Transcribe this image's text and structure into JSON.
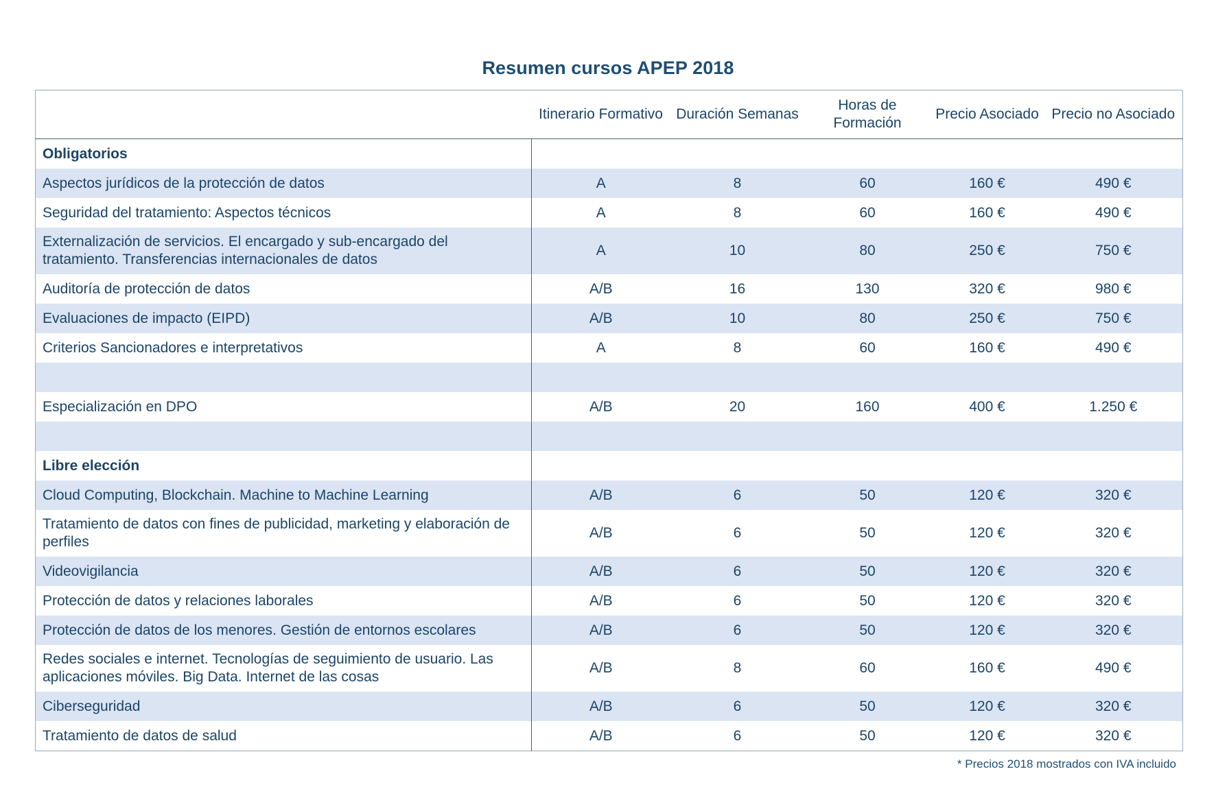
{
  "title": "Resumen cursos APEP 2018",
  "headers": {
    "course": "",
    "itinerario": "Itinerario Formativo",
    "duracion": "Duración Semanas",
    "horas": "Horas de Formación",
    "precio_asociado": "Precio Asociado",
    "precio_no_asociado": "Precio no Asociado"
  },
  "sections": {
    "obligatorios": "Obligatorios",
    "libre": "Libre elección"
  },
  "obligatorios": [
    {
      "name": "Aspectos jurídicos de la protección de datos",
      "itin": "A",
      "dur": "8",
      "hrs": "60",
      "pa": "160 €",
      "pna": "490 €"
    },
    {
      "name": "Seguridad del tratamiento: Aspectos técnicos",
      "itin": "A",
      "dur": "8",
      "hrs": "60",
      "pa": "160 €",
      "pna": "490 €"
    },
    {
      "name": "Externalización de servicios. El encargado y sub-encargado del tratamiento. Transferencias internacionales de datos",
      "itin": "A",
      "dur": "10",
      "hrs": "80",
      "pa": "250 €",
      "pna": "750 €"
    },
    {
      "name": "Auditoría de protección de datos",
      "itin": "A/B",
      "dur": "16",
      "hrs": "130",
      "pa": "320 €",
      "pna": "980 €"
    },
    {
      "name": "Evaluaciones de impacto (EIPD)",
      "itin": "A/B",
      "dur": "10",
      "hrs": "80",
      "pa": "250 €",
      "pna": "750 €"
    },
    {
      "name": "Criterios Sancionadores e interpretativos",
      "itin": "A",
      "dur": "8",
      "hrs": "60",
      "pa": "160 €",
      "pna": "490 €"
    }
  ],
  "especializacion": {
    "name": "Especialización en DPO",
    "itin": "A/B",
    "dur": "20",
    "hrs": "160",
    "pa": "400 €",
    "pna": "1.250 €"
  },
  "libre": [
    {
      "name": "Cloud Computing, Blockchain. Machine to Machine Learning",
      "itin": "A/B",
      "dur": "6",
      "hrs": "50",
      "pa": "120 €",
      "pna": "320 €"
    },
    {
      "name": "Tratamiento de datos con fines de publicidad, marketing y elaboración de perfiles",
      "itin": "A/B",
      "dur": "6",
      "hrs": "50",
      "pa": "120 €",
      "pna": "320 €"
    },
    {
      "name": "Videovigilancia",
      "itin": "A/B",
      "dur": "6",
      "hrs": "50",
      "pa": "120 €",
      "pna": "320 €"
    },
    {
      "name": "Protección de datos y relaciones laborales",
      "itin": "A/B",
      "dur": "6",
      "hrs": "50",
      "pa": "120 €",
      "pna": "320 €"
    },
    {
      "name": "Protección de datos de los menores. Gestión de entornos escolares",
      "itin": "A/B",
      "dur": "6",
      "hrs": "50",
      "pa": "120 €",
      "pna": "320 €"
    },
    {
      "name": "Redes sociales e internet. Tecnologías de seguimiento de usuario. Las aplicaciones móviles. Big Data. Internet de las cosas",
      "itin": "A/B",
      "dur": "8",
      "hrs": "60",
      "pa": "160 €",
      "pna": "490 €"
    },
    {
      "name": "Ciberseguridad",
      "itin": "A/B",
      "dur": "6",
      "hrs": "50",
      "pa": "120 €",
      "pna": "320 €"
    },
    {
      "name": "Tratamiento de datos de salud",
      "itin": "A/B",
      "dur": "6",
      "hrs": "50",
      "pa": "120 €",
      "pna": "320 €"
    }
  ],
  "footnote": "* Precios 2018 mostrados con IVA incluido",
  "colors": {
    "title": "#1d4e74",
    "text": "#1b4468",
    "row_shade": "#dbe4f3",
    "rule": "#555d66"
  }
}
